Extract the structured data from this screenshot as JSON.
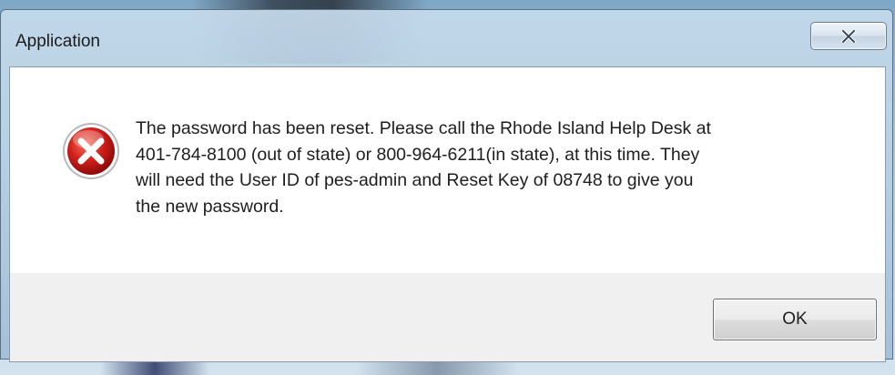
{
  "window": {
    "title": "Application"
  },
  "dialog": {
    "icon": "error-icon",
    "message": "The password has been reset.  Please call the Rhode Island Help Desk at\n401-784-8100 (out of state) or 800-964-6211(in state), at this time.  They\nwill need the User ID of pes-admin and Reset Key of 08748 to give you\nthe new password.",
    "ok_label": "OK"
  },
  "colors": {
    "error_red": "#d0201b",
    "frame_glass": "#b7cfe3",
    "content_bg": "#ffffff",
    "button_area_bg": "#f0f0f0"
  }
}
